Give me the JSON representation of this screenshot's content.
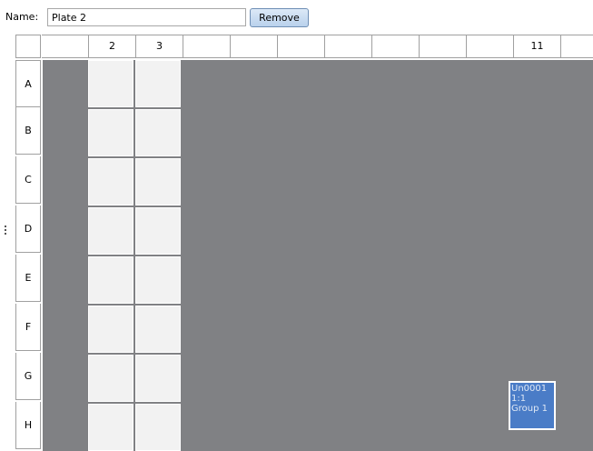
{
  "header": {
    "name_label": "Name:",
    "name_value": "Plate 2",
    "remove_label": "Remove"
  },
  "plate": {
    "columns": [
      "",
      "2",
      "3",
      "",
      "",
      "",
      "",
      "",
      "",
      "",
      "11",
      ""
    ],
    "rows": [
      "A",
      "B",
      "C",
      "D",
      "E",
      "F",
      "G",
      "H"
    ],
    "sample": {
      "id": "Un0001",
      "ratio": "1:1",
      "group": "Group 1",
      "row": "G",
      "column": "11"
    }
  },
  "colors": {
    "plate_background": "#808184",
    "empty_well": "#f2f2f2",
    "sample_well": "#4a7cc7",
    "button_face": "#c9dcf2"
  },
  "icons": {
    "splitter_grip": "grip-dots-icon"
  }
}
